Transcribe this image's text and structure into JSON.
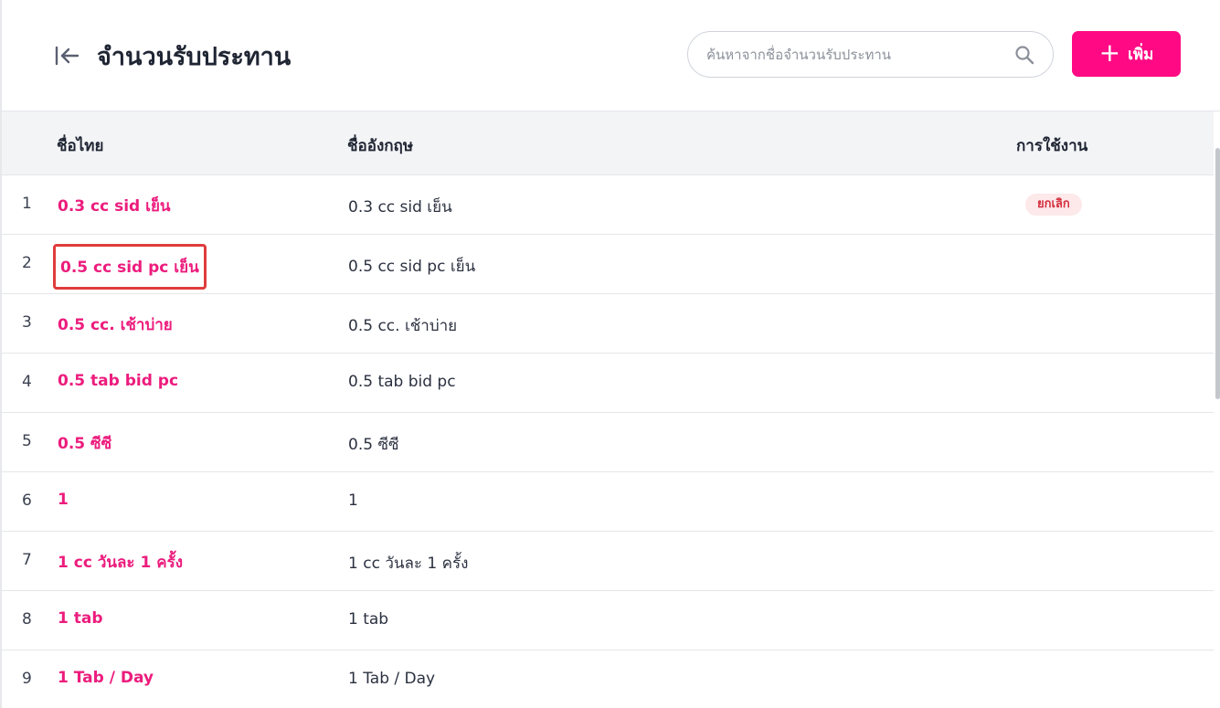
{
  "header": {
    "title": "จำนวนรับประทาน",
    "back_icon": "collapse-left-icon",
    "search": {
      "placeholder": "ค้นหาจากชื่อจำนวนรับประทาน",
      "value": ""
    },
    "add_button": {
      "icon": "plus-icon",
      "label": "เพิ่ม",
      "color": "#ff0a84"
    }
  },
  "table": {
    "columns": [
      "ชื่อไทย",
      "ชื่ออังกฤษ",
      "การใช้งาน"
    ],
    "rows": [
      {
        "index": "1",
        "name_th": "0.3 cc sid เย็น",
        "name_en": "0.3 cc sid เย็น",
        "status": "ยกเลิก"
      },
      {
        "index": "2",
        "name_th": "0.5 cc sid pc เย็น",
        "name_en": "0.5 cc sid pc เย็น",
        "status": ""
      },
      {
        "index": "3",
        "name_th": "0.5 cc. เช้าบ่าย",
        "name_en": "0.5 cc. เช้าบ่าย",
        "status": ""
      },
      {
        "index": "4",
        "name_th": "0.5 tab bid pc",
        "name_en": "0.5 tab bid pc",
        "status": ""
      },
      {
        "index": "5",
        "name_th": "0.5 ซีซี",
        "name_en": "0.5 ซีซี",
        "status": ""
      },
      {
        "index": "6",
        "name_th": "1",
        "name_en": "1",
        "status": ""
      },
      {
        "index": "7",
        "name_th": "1 cc วันละ 1 ครั้ง",
        "name_en": "1 cc วันละ 1 ครั้ง",
        "status": ""
      },
      {
        "index": "8",
        "name_th": "1 tab",
        "name_en": "1 tab",
        "status": ""
      },
      {
        "index": "9",
        "name_th": "1 Tab / Day",
        "name_en": "1 Tab / Day",
        "status": ""
      }
    ]
  },
  "colors": {
    "accent": "#ff0a84",
    "link": "#ec1c7d",
    "cancel_badge_bg": "#fde8ea",
    "cancel_badge_text": "#d32f3d"
  }
}
